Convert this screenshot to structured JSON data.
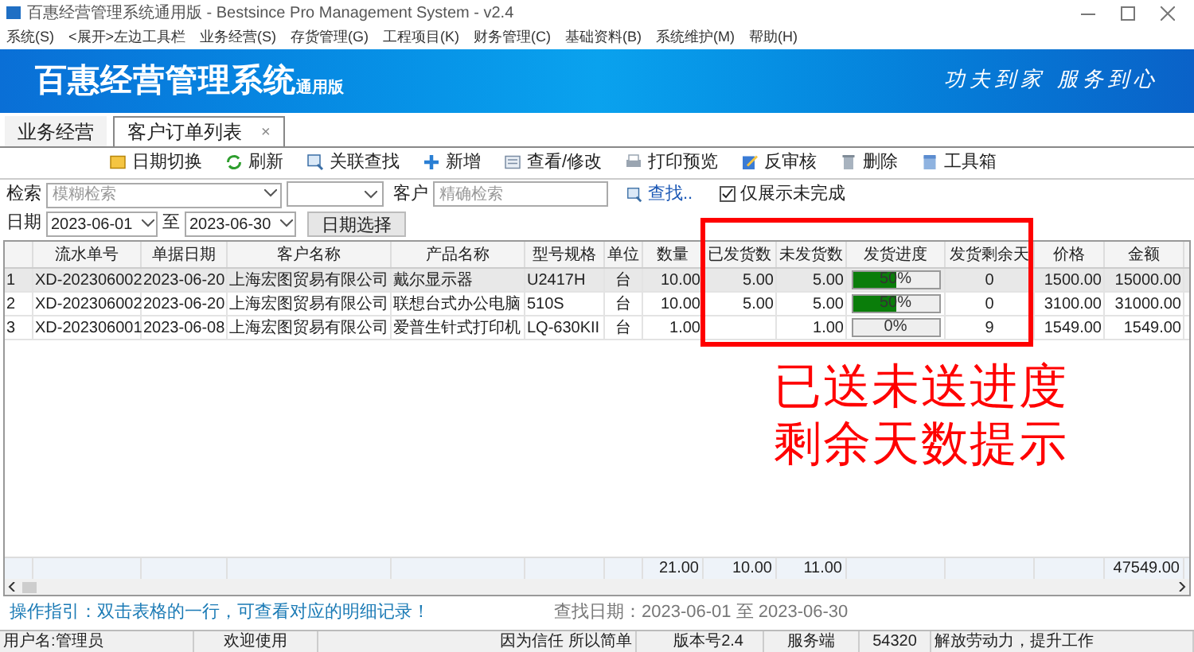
{
  "window": {
    "title": "百惠经营管理系统通用版 - Bestsince Pro Management System - v2.4"
  },
  "menu": [
    "系统(S)",
    "<展开>左边工具栏",
    "业务经营(S)",
    "存货管理(G)",
    "工程项目(K)",
    "财务管理(C)",
    "基础资料(B)",
    "系统维护(M)",
    "帮助(H)"
  ],
  "banner": {
    "title": "百惠经营管理系统",
    "edition": "通用版",
    "slogan": "功夫到家 服务到心"
  },
  "tabs": [
    {
      "label": "业务经营",
      "selected": false
    },
    {
      "label": "客户订单列表",
      "selected": true,
      "close": "×"
    }
  ],
  "toolbar": [
    {
      "label": "日期切换",
      "kind": "calendar"
    },
    {
      "label": "刷新",
      "kind": "refresh"
    },
    {
      "label": "关联查找",
      "kind": "search"
    },
    {
      "label": "新增",
      "kind": "add"
    },
    {
      "label": "查看/修改",
      "kind": "view"
    },
    {
      "label": "打印预览",
      "kind": "print"
    },
    {
      "label": "反审核",
      "kind": "edit"
    },
    {
      "label": "删除",
      "kind": "trash"
    },
    {
      "label": "工具箱",
      "kind": "box"
    }
  ],
  "filters": {
    "search_label": "检索",
    "search_placeholder": "模糊检索",
    "customer_label": "客户",
    "customer_placeholder": "精确检索",
    "find_link": "查找..",
    "only_incomplete": {
      "label": "仅展示未完成",
      "checked": true
    },
    "date_label": "日期",
    "date_from": "2023-06-01",
    "to_label": "至",
    "date_to": "2023-06-30",
    "date_button": "日期选择"
  },
  "table": {
    "columns": [
      "",
      "流水单号",
      "单据日期",
      "客户名称",
      "产品名称",
      "型号规格",
      "单位",
      "数量",
      "已发货数",
      "未发货数",
      "发货进度",
      "发货剩余天",
      "价格",
      "金额"
    ],
    "rows": [
      {
        "cells": [
          "1",
          "XD-202306002",
          "2023-06-20",
          "上海宏图贸易有限公司",
          "戴尔显示器",
          "U2417H",
          "台",
          "10.00",
          "5.00",
          "5.00",
          {
            "level": 0.5,
            "label": "50%"
          },
          "0",
          "1500.00",
          "15000.00"
        ],
        "selected": true
      },
      {
        "cells": [
          "2",
          "XD-202306002",
          "2023-06-20",
          "上海宏图贸易有限公司",
          "联想台式办公电脑",
          "510S",
          "台",
          "10.00",
          "5.00",
          "5.00",
          {
            "level": 0.5,
            "label": "50%"
          },
          "0",
          "3100.00",
          "31000.00"
        ],
        "selected": false
      },
      {
        "cells": [
          "3",
          "XD-202306001",
          "2023-06-08",
          "上海宏图贸易有限公司",
          "爱普生针式打印机",
          "LQ-630KII",
          "台",
          "1.00",
          null,
          "1.00",
          {
            "level": 0,
            "label": "0%"
          },
          "9",
          "1549.00",
          "1549.00"
        ],
        "selected": false
      }
    ],
    "totals": {
      "quantity": "21.00",
      "shipped": "10.00",
      "unshipped": "11.00",
      "amount": "47549.00"
    }
  },
  "guide": "操作指引：双击表格的一行，可查看对应的明细记录！",
  "query_range": "查找日期：2023-06-01 至 2023-06-30",
  "status_bar": [
    "用户名:管理员",
    "欢迎使用",
    "因为信任 所以简单",
    "版本号2.4",
    "服务端",
    "54320",
    "解放劳动力，提升工作"
  ],
  "annotation": {
    "lines": [
      "已送未送进度",
      "剩余天数提示"
    ]
  }
}
